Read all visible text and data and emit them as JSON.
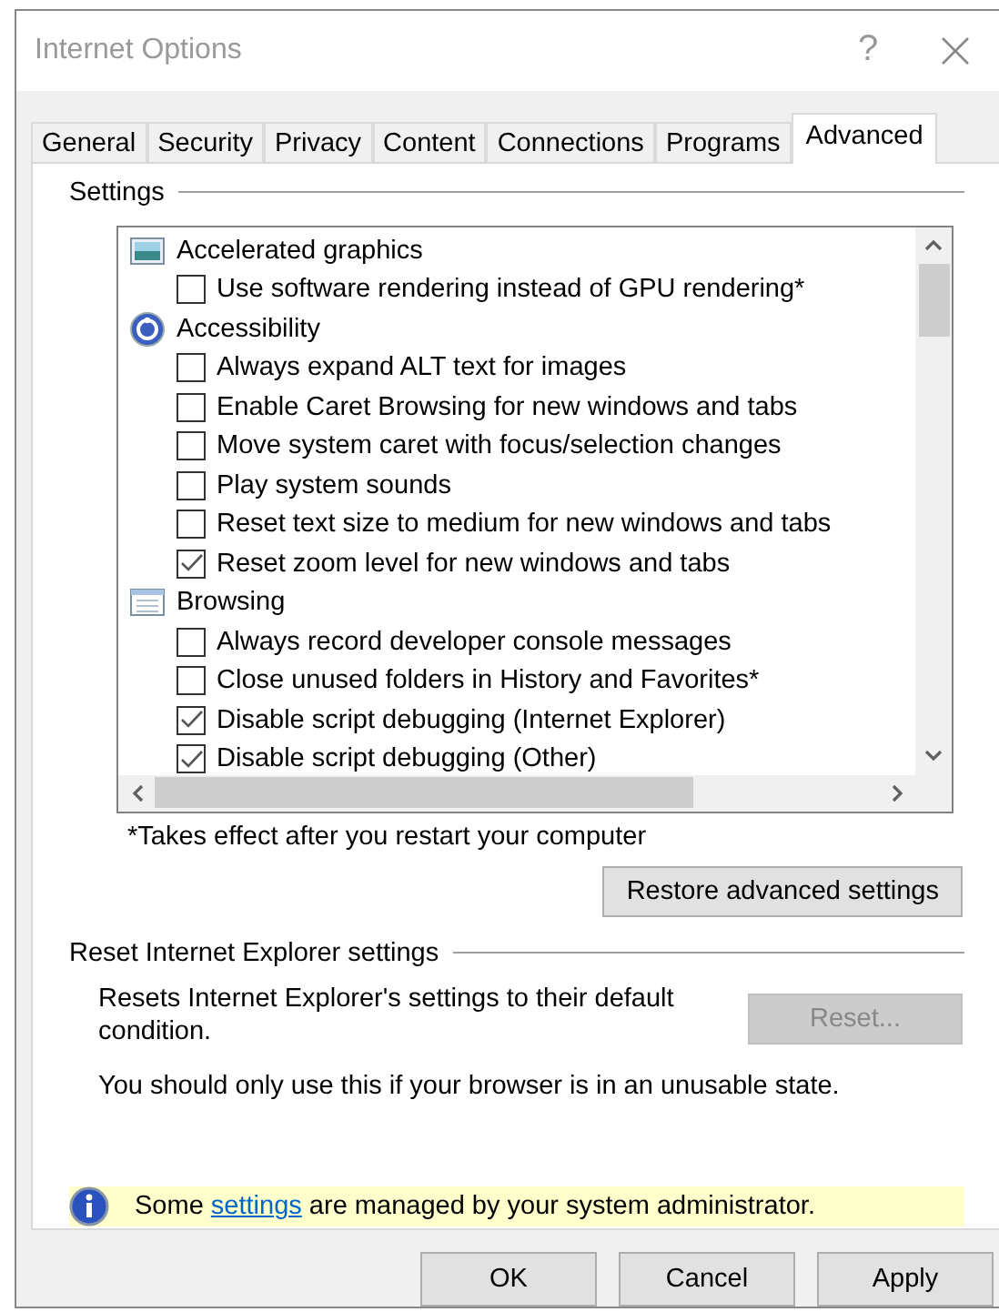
{
  "window": {
    "title": "Internet Options",
    "help": "?"
  },
  "tabs": [
    {
      "label": "General",
      "selected": false
    },
    {
      "label": "Security",
      "selected": false
    },
    {
      "label": "Privacy",
      "selected": false
    },
    {
      "label": "Content",
      "selected": false
    },
    {
      "label": "Connections",
      "selected": false
    },
    {
      "label": "Programs",
      "selected": false
    },
    {
      "label": "Advanced",
      "selected": true
    }
  ],
  "settings": {
    "title": "Settings",
    "tree": [
      {
        "label": "Accelerated graphics",
        "kind": "monitor",
        "children": [
          {
            "label": "Use software rendering instead of GPU rendering*",
            "checked": false
          }
        ]
      },
      {
        "label": "Accessibility",
        "kind": "accessibility",
        "children": [
          {
            "label": "Always expand ALT text for images",
            "checked": false
          },
          {
            "label": "Enable Caret Browsing for new windows and tabs",
            "checked": false
          },
          {
            "label": "Move system caret with focus/selection changes",
            "checked": false
          },
          {
            "label": "Play system sounds",
            "checked": false
          },
          {
            "label": "Reset text size to medium for new windows and tabs",
            "checked": false
          },
          {
            "label": "Reset zoom level for new windows and tabs",
            "checked": true
          }
        ]
      },
      {
        "label": "Browsing",
        "kind": "window",
        "children": [
          {
            "label": "Always record developer console messages",
            "checked": false
          },
          {
            "label": "Close unused folders in History and Favorites*",
            "checked": false
          },
          {
            "label": "Disable script debugging (Internet Explorer)",
            "checked": true
          },
          {
            "label": "Disable script debugging (Other)",
            "checked": true
          }
        ]
      }
    ],
    "footnote": "*Takes effect after you restart your computer",
    "restore_button": "Restore advanced settings"
  },
  "reset": {
    "title": "Reset Internet Explorer settings",
    "description": "Resets Internet Explorer's settings to their default condition.",
    "button": {
      "label": "Reset...",
      "disabled": true
    },
    "warning": "You should only use this if your browser is in an unusable state."
  },
  "notice": {
    "before": "Some ",
    "link": "settings",
    "after": " are managed by your system administrator."
  },
  "buttons": [
    "OK",
    "Cancel",
    "Apply"
  ]
}
